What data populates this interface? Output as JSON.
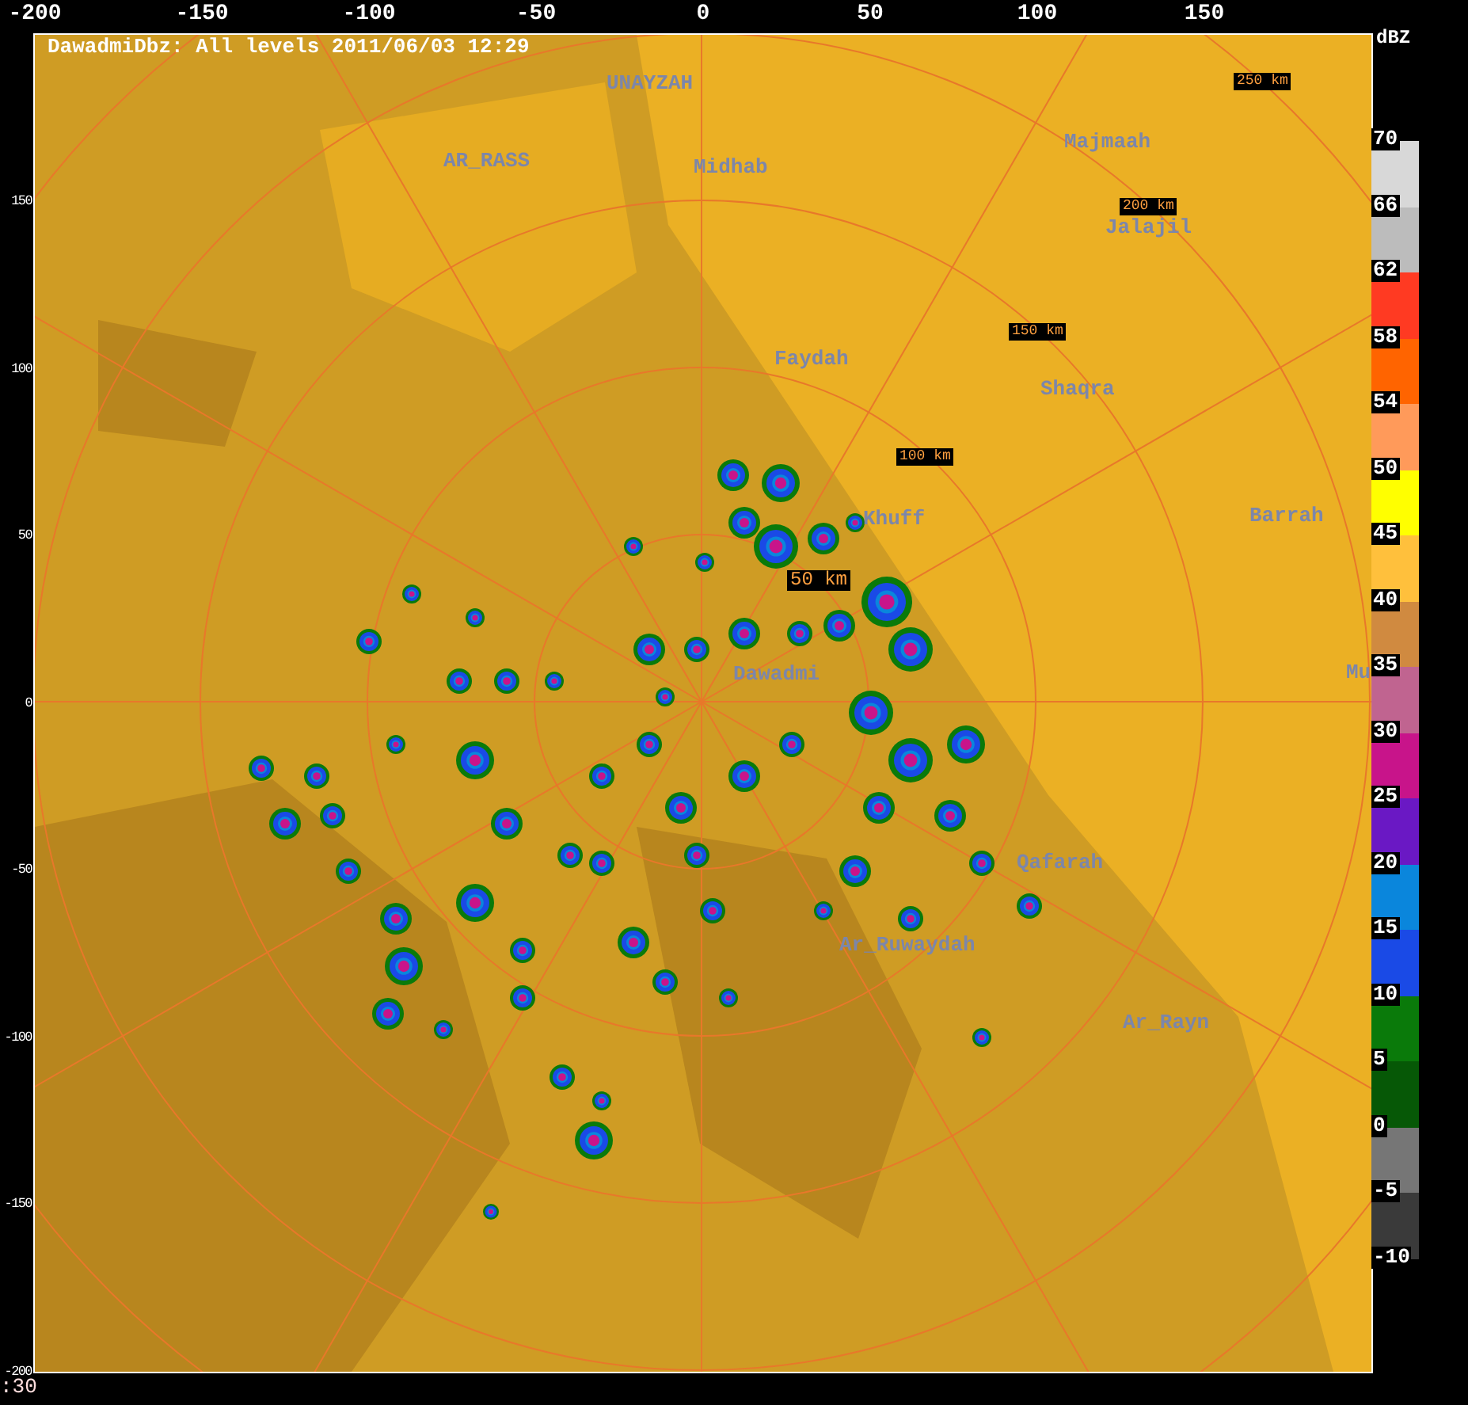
{
  "title": "DawadmiDbz: All levels 2011/06/03 12:29",
  "x_axis": [
    "-200",
    "-150",
    "-100",
    "-50",
    "0",
    "50",
    "100",
    "150"
  ],
  "y_axis": [
    "150",
    "100",
    "50",
    "0",
    "-50",
    "-100",
    "-150",
    "-200"
  ],
  "places": [
    {
      "name": "UNAYZAH"
    },
    {
      "name": "AR_RASS"
    },
    {
      "name": "Midhab"
    },
    {
      "name": "Majmaah"
    },
    {
      "name": "Jalajil"
    },
    {
      "name": "Faydah"
    },
    {
      "name": "Shaqra"
    },
    {
      "name": "Khuff"
    },
    {
      "name": "Barrah"
    },
    {
      "name": "Mu"
    },
    {
      "name": "Dawadmi"
    },
    {
      "name": "Qafarah"
    },
    {
      "name": "Ar_Ruwaydah"
    },
    {
      "name": "Ar_Rayn"
    }
  ],
  "range_labels": [
    "250 km",
    "200 km",
    "150 km",
    "100 km",
    "50 km"
  ],
  "scale": {
    "unit": "dBZ",
    "bands": [
      {
        "top_label": "70",
        "color": "#d8d8d8"
      },
      {
        "top_label": "66",
        "color": "#bcbcbc"
      },
      {
        "top_label": "62",
        "color": "#ff3a22"
      },
      {
        "top_label": "58",
        "color": "#ff6400"
      },
      {
        "top_label": "54",
        "color": "#ff9a5a"
      },
      {
        "top_label": "50",
        "color": "#ffff00"
      },
      {
        "top_label": "45",
        "color": "#ffc03c"
      },
      {
        "top_label": "40",
        "color": "#d08a40"
      },
      {
        "top_label": "35",
        "color": "#c06490"
      },
      {
        "top_label": "30",
        "color": "#c8148a"
      },
      {
        "top_label": "25",
        "color": "#6a18c4"
      },
      {
        "top_label": "20",
        "color": "#0a86dc"
      },
      {
        "top_label": "15",
        "color": "#1a4ae6"
      },
      {
        "top_label": "10",
        "color": "#0a7a0a"
      },
      {
        "top_label": "5",
        "color": "#065806"
      },
      {
        "top_label": "0",
        "color": "#767676"
      },
      {
        "top_label": "-5",
        "color": "#3a3a3a"
      }
    ],
    "bottom_label": "-10"
  },
  "footer": ":30"
}
